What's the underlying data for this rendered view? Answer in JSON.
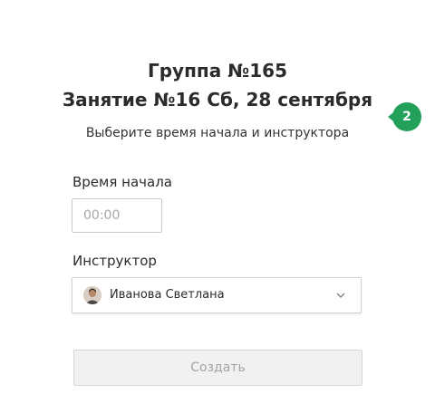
{
  "header": {
    "group_title": "Группа №165",
    "lesson_title": "Занятие №16 Сб, 28 сентября",
    "subtitle": "Выберите время начала и инструктора"
  },
  "step_badge": {
    "value": "2",
    "color": "#23a15a"
  },
  "form": {
    "start_time": {
      "label": "Время начала",
      "placeholder": "00:00",
      "value": ""
    },
    "instructor": {
      "label": "Инструктор",
      "selected": "Иванова Светлана",
      "avatar_icon": "user-photo",
      "dropdown_icon": "chevron-down-icon"
    },
    "submit": {
      "label": "Создать",
      "state": "disabled"
    }
  }
}
